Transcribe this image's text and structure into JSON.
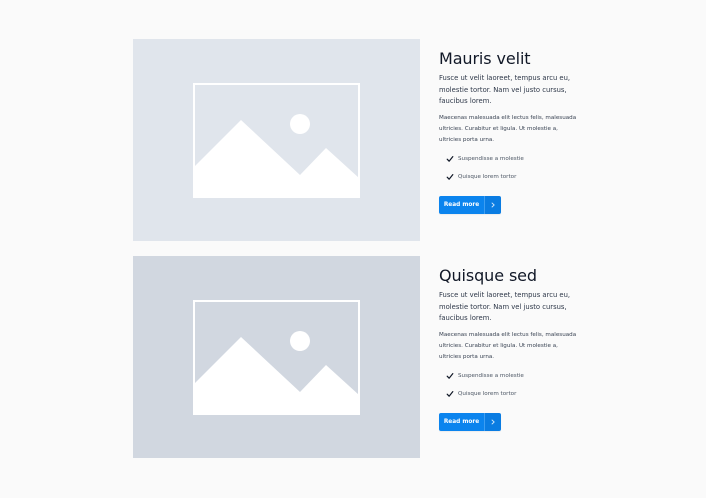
{
  "colors": {
    "page_bg": "#fafafa",
    "placeholder_bg_1": "#e0e5ec",
    "placeholder_bg_2": "#d1d7e0",
    "placeholder_fg": "#ffffff",
    "button_bg": "#0b84ee",
    "text_dark": "#111827"
  },
  "cards": [
    {
      "image_icon": "image-placeholder-icon",
      "title": "Mauris velit",
      "lead": "Fusce ut velit laoreet, tempus arcu eu, molestie tortor. Nam vel justo cursus, faucibus lorem.",
      "body": "Maecenas malesuada elit lectus felis, malesuada ultricies. Curabitur et ligula. Ut molestie a, ultricies porta urna.",
      "checklist": [
        {
          "icon": "check-icon",
          "label": "Suspendisse a molestie"
        },
        {
          "icon": "check-icon",
          "label": "Quisque lorem tortor"
        }
      ],
      "button_label": "Read more",
      "button_icon": "arrow-right-icon"
    },
    {
      "image_icon": "image-placeholder-icon",
      "title": "Quisque sed",
      "lead": "Fusce ut velit laoreet, tempus arcu eu, molestie tortor. Nam vel justo cursus, faucibus lorem.",
      "body": "Maecenas malesuada elit lectus felis, malesuada ultricies. Curabitur et ligula. Ut molestie a, ultricies porta urna.",
      "checklist": [
        {
          "icon": "check-icon",
          "label": "Suspendisse a molestie"
        },
        {
          "icon": "check-icon",
          "label": "Quisque lorem tortor"
        }
      ],
      "button_label": "Read more",
      "button_icon": "arrow-right-icon"
    }
  ]
}
